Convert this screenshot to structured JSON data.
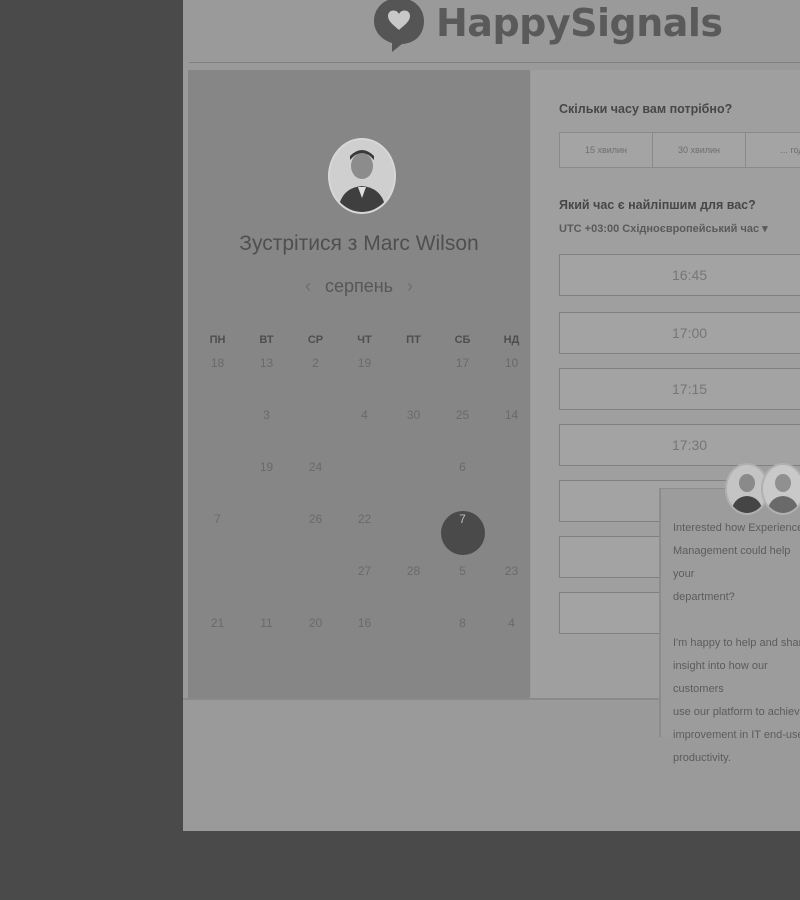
{
  "brand": {
    "name": "HappySignals"
  },
  "calendar": {
    "title": "Зустрітися з Marc Wilson",
    "month": "серпень",
    "prev_icon": "‹",
    "next_icon": "›",
    "weekdays": [
      "ПН",
      "ВТ",
      "СР",
      "ЧТ",
      "ПТ",
      "СБ",
      "НД"
    ],
    "days": [
      [
        "18",
        "13",
        "2",
        "19",
        "",
        "17",
        "10"
      ],
      [
        "",
        "3",
        "",
        "4",
        "30",
        "25",
        "14"
      ],
      [
        "",
        "19",
        "24",
        "",
        "",
        "6",
        ""
      ],
      [
        "7",
        "",
        "26",
        "22",
        "",
        "7",
        ""
      ],
      [
        "",
        "",
        "",
        "27",
        "28",
        "5",
        "23"
      ],
      [
        "21",
        "11",
        "20",
        "16",
        "",
        "8",
        "4"
      ]
    ],
    "selected_day": "7"
  },
  "booking": {
    "duration_question": "Скільки часу вам потрібно?",
    "durations": [
      "15 хвилин",
      "30 хвилин",
      "... год"
    ],
    "time_question": "Який час є найліпшим для вас?",
    "timezone": "UTC +03:00 Східноєвропейський час ▾",
    "slots": [
      "16:45",
      "17:00",
      "17:15",
      "17:30"
    ]
  },
  "chat": {
    "message": "Interested how Experience\nManagement could help your\ndepartment?\n\nI'm happy to help and share\ninsight into how our customers\nuse our platform to achieve\nimprovement in IT end-user\nproductivity."
  },
  "colors": {
    "page_bg": "#4a4a4a",
    "selected_day": "#4a4a4a",
    "panel": "#868686"
  }
}
